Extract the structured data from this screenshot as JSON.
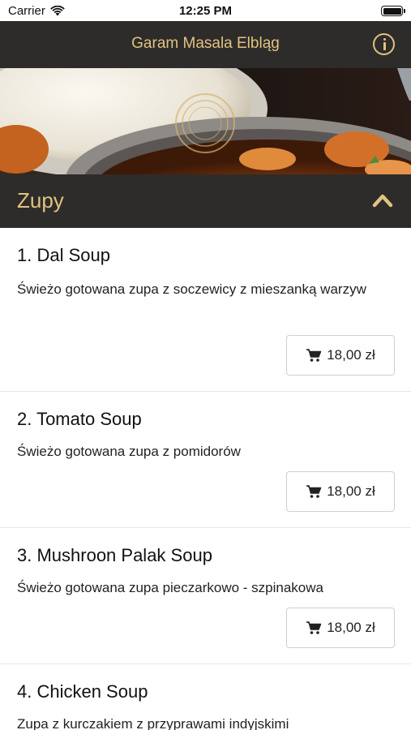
{
  "status": {
    "carrier": "Carrier",
    "time": "12:25 PM"
  },
  "nav": {
    "title": "Garam Masala Elbląg",
    "info_icon": "info-circle-icon"
  },
  "banner": {
    "alt": "food-banner"
  },
  "category": {
    "title": "Zupy",
    "expand_icon": "chevron-up-icon"
  },
  "items": [
    {
      "name": "1. Dal Soup",
      "description": "Świeżo gotowana zupa z soczewicy z mieszanką warzyw",
      "price": "18,00 zł"
    },
    {
      "name": "2. Tomato Soup",
      "description": "Świeżo gotowana zupa z pomidorów",
      "price": "18,00 zł"
    },
    {
      "name": "3. Mushroon Palak Soup",
      "description": "Świeżo gotowana zupa pieczarkowo - szpinakowa",
      "price": "18,00 zł"
    },
    {
      "name": "4. Chicken Soup",
      "description": "Zupa z kurczakiem z przyprawami indyjskimi",
      "price": ""
    }
  ],
  "colors": {
    "bar": "#2d2c2a",
    "accent": "#e2c27f"
  }
}
